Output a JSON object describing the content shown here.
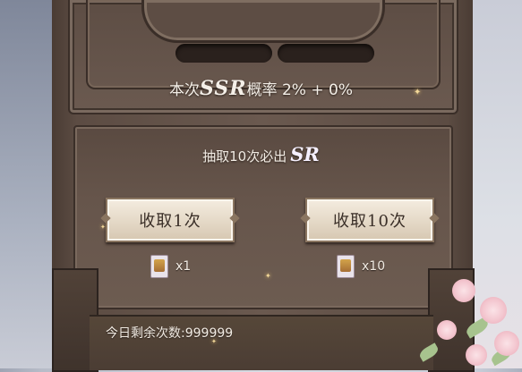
{
  "rate": {
    "prefix": "本次",
    "tier": "SSR",
    "label": "概率",
    "value": "2% + 0%"
  },
  "guarantee": {
    "text": "抽取10次必出",
    "tier": "SR"
  },
  "buttons": {
    "draw_one": "收取1次",
    "draw_ten": "收取10次"
  },
  "costs": {
    "one": "x1",
    "ten": "x10"
  },
  "remaining": {
    "label": "今日剩余次数:",
    "value": "999999"
  },
  "icons": {
    "ticket": "draw-ticket-icon",
    "sparkle": "sparkle-icon",
    "flower": "cherry-blossom-decoration"
  },
  "colors": {
    "wood": "#5d4d44",
    "button": "#e7dccb",
    "text": "#f4efe8"
  }
}
